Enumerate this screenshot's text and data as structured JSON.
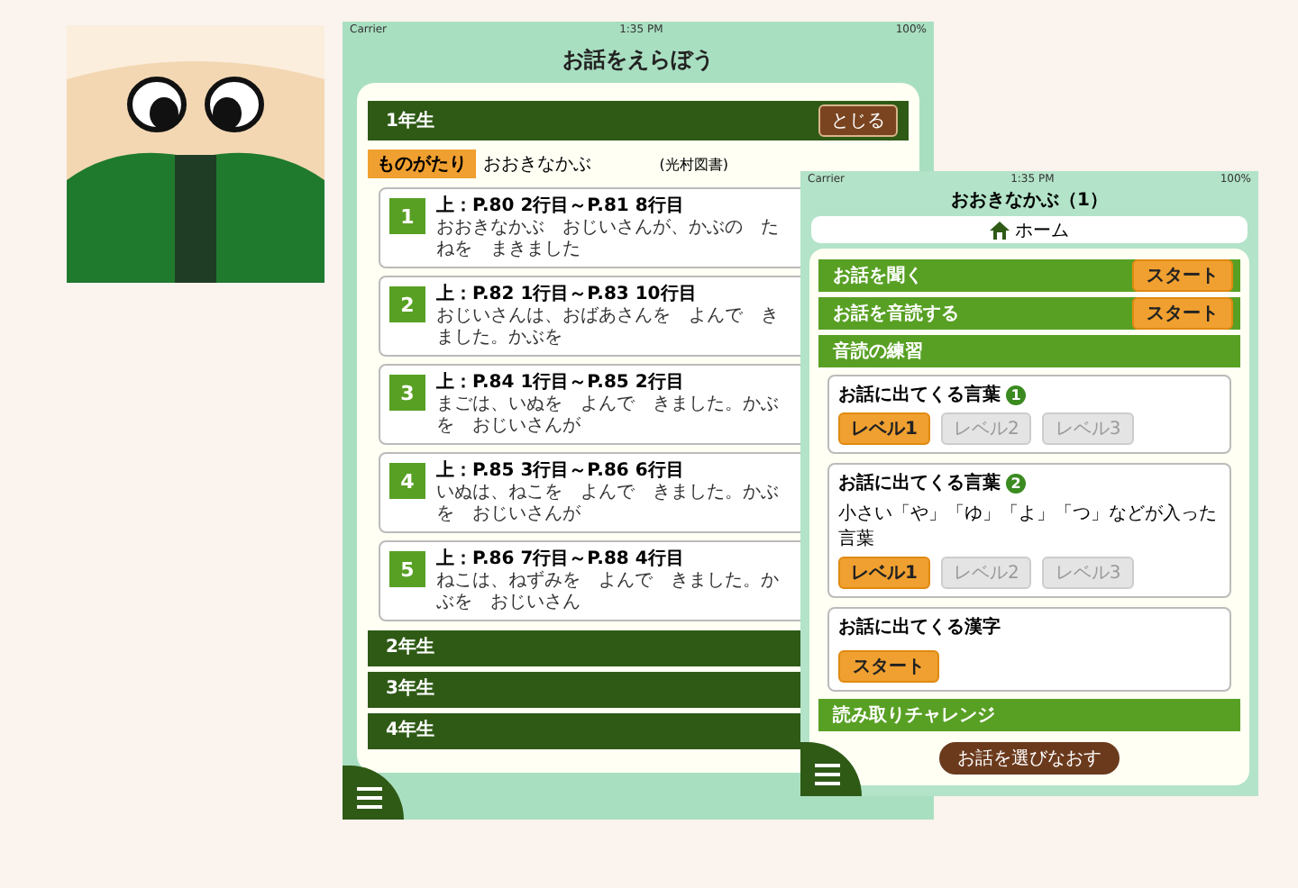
{
  "left_screen": {
    "status": {
      "carrier": "Carrier",
      "time": "1:35 PM",
      "battery": "100%"
    },
    "title": "お話をえらぼう",
    "open_grade": {
      "label": "1年生",
      "close_button": "とじる"
    },
    "category": {
      "tag": "ものがたり",
      "title": "おおきなかぶ",
      "publisher": "(光村図書)"
    },
    "sections": [
      {
        "number": "1",
        "range": "上：P.80 2行目～P.81 8行目",
        "excerpt": "おおきなかぶ　おじいさんが、かぶの　たねを　まきました"
      },
      {
        "number": "2",
        "range": "上：P.82 1行目～P.83 10行目",
        "excerpt": "おじいさんは、おばあさんを　よんで　きました。かぶを"
      },
      {
        "number": "3",
        "range": "上：P.84 1行目～P.85 2行目",
        "excerpt": "まごは、いぬを　よんで　きました。かぶを　おじいさんが"
      },
      {
        "number": "4",
        "range": "上：P.85 3行目～P.86 6行目",
        "excerpt": "いぬは、ねこを　よんで　きました。かぶを　おじいさんが"
      },
      {
        "number": "5",
        "range": "上：P.86 7行目～P.88 4行目",
        "excerpt": "ねこは、ねずみを　よんで　きました。かぶを　おじいさん"
      }
    ],
    "grades": [
      "2年生",
      "3年生",
      "4年生"
    ]
  },
  "right_screen": {
    "status": {
      "carrier": "Carrier",
      "time": "1:35 PM",
      "battery": "100%"
    },
    "title": "おおきなかぶ（1）",
    "home": "ホーム",
    "items": [
      {
        "kind": "action",
        "label": "お話を聞く",
        "button": "スタート"
      },
      {
        "kind": "action",
        "label": "お話を音読する",
        "button": "スタート"
      },
      {
        "kind": "header",
        "label": "音読の練習"
      },
      {
        "kind": "levels",
        "title": "お話に出てくる言葉",
        "badge": "1",
        "levels": [
          {
            "label": "レベル1",
            "selected": true
          },
          {
            "label": "レベル2",
            "selected": false
          },
          {
            "label": "レベル3",
            "selected": false
          }
        ]
      },
      {
        "kind": "levels",
        "title": "お話に出てくる言葉",
        "badge": "2",
        "note": "小さい「や」「ゆ」「よ」「つ」などが入った言葉",
        "levels": [
          {
            "label": "レベル1",
            "selected": true
          },
          {
            "label": "レベル2",
            "selected": false
          },
          {
            "label": "レベル3",
            "selected": false
          }
        ]
      },
      {
        "kind": "start",
        "title": "お話に出てくる漢字",
        "button": "スタート"
      },
      {
        "kind": "header",
        "label": "読み取りチャレンジ"
      }
    ],
    "reselect_button": "お話を選びなおす"
  }
}
